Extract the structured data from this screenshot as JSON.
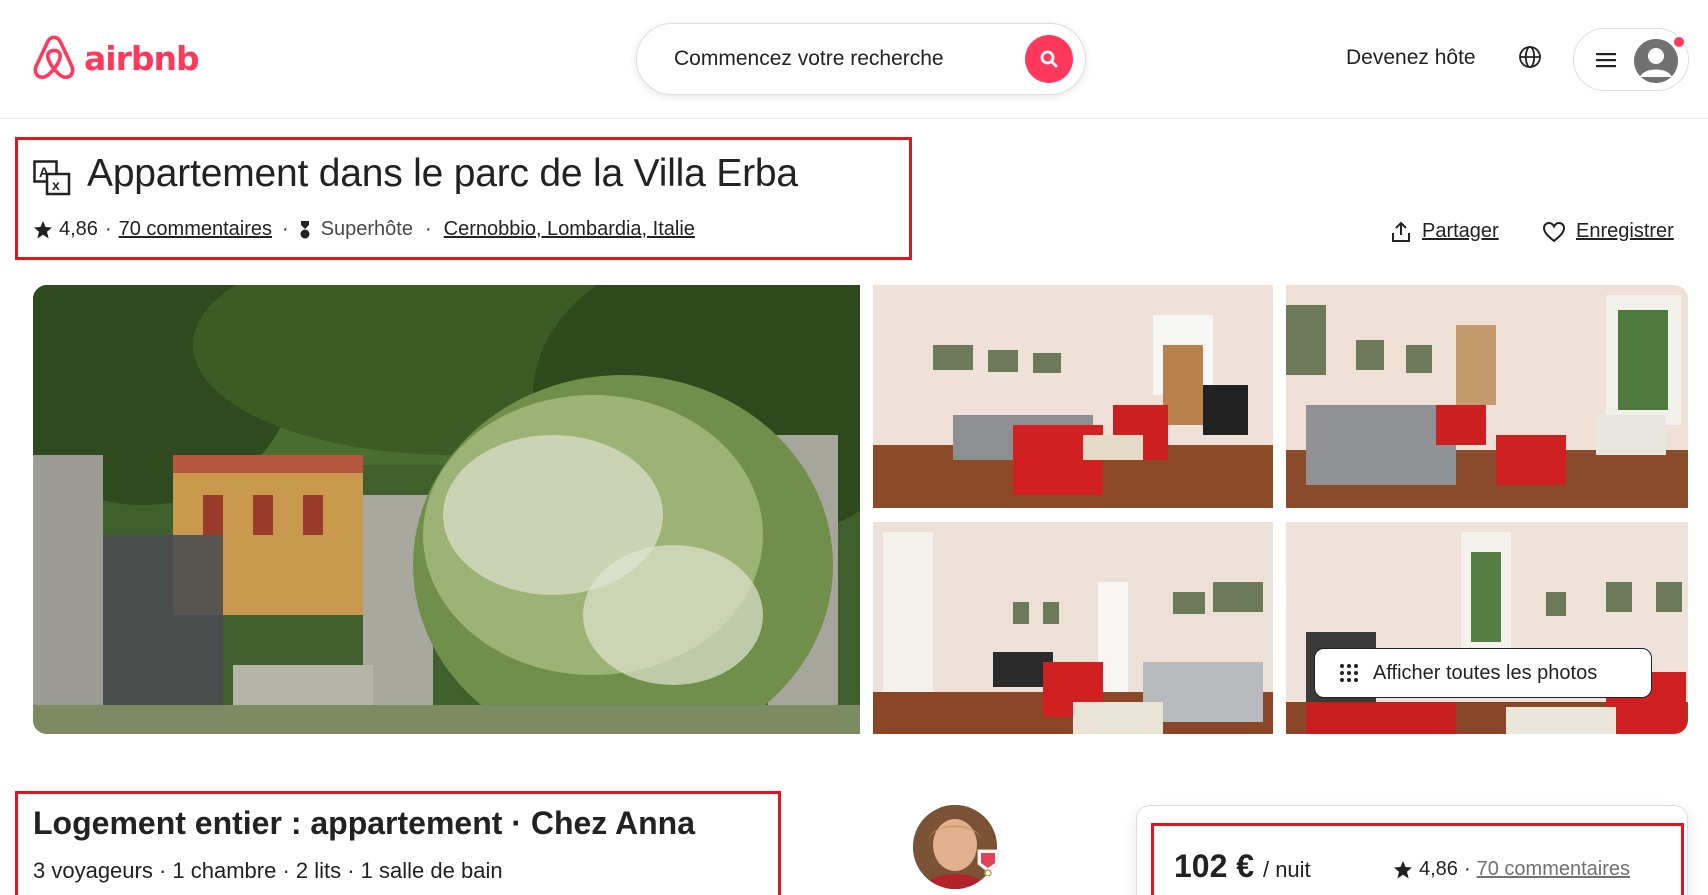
{
  "header": {
    "logo_text": "airbnb",
    "search_placeholder": "Commencez votre recherche",
    "host_link": "Devenez hôte",
    "brand_color": "#FF385C",
    "icons": [
      "airbnb-logo-icon",
      "search-icon",
      "globe-icon",
      "menu-icon",
      "user-avatar-icon"
    ]
  },
  "listing": {
    "title": "Appartement dans le parc de la Villa Erba",
    "rating": "4,86",
    "reviews": "70 commentaires",
    "superhost": "Superhôte",
    "location": "Cernobbio, Lombardia, Italie",
    "share_label": "Partager",
    "save_label": "Enregistrer"
  },
  "photos": {
    "show_all_label": "Afficher toutes les photos"
  },
  "details": {
    "title": "Logement entier : appartement · Chez Anna",
    "summary": "3 voyageurs · 1 chambre · 2 lits · 1 salle de bain"
  },
  "booking": {
    "price": "102 €",
    "unit": "/ nuit",
    "rating": "4,86",
    "reviews": "70 commentaires"
  },
  "highlight_color": "#E0161E"
}
